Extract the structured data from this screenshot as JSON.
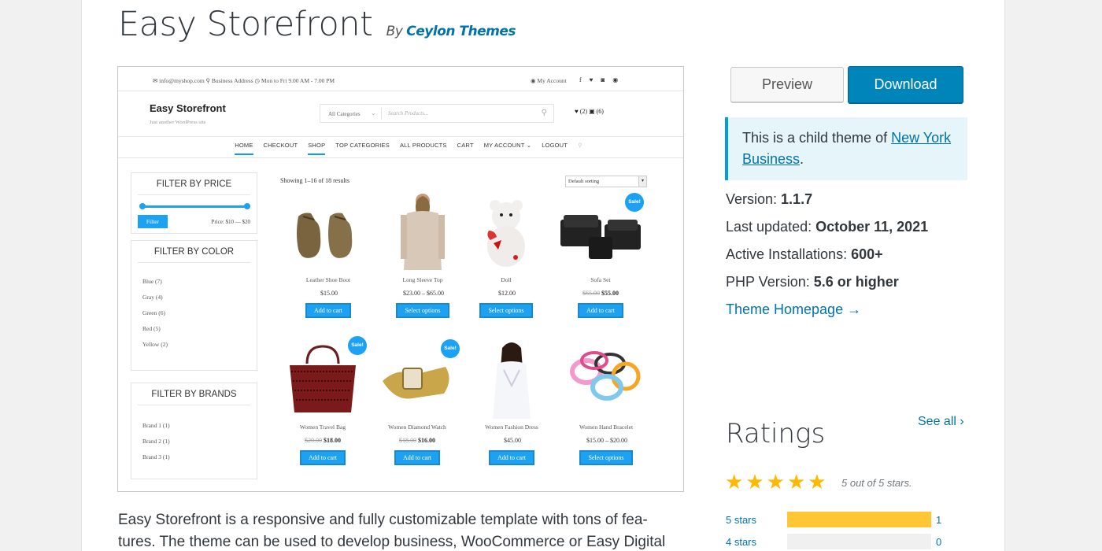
{
  "theme": {
    "title": "Easy Storefront",
    "by_prefix": "By",
    "author": "Ceylon Themes"
  },
  "screenshot": {
    "topbar": {
      "left": "✉ info@myshop.com   ⚲ Business Address   ◷ Mon to Fri 9.00 AM - 7.00 PM",
      "account": "◉ My Account"
    },
    "brand": "Easy Storefront",
    "tagline": "Just another WordPress site",
    "category": "All Categories",
    "search_placeholder": "Search Products...",
    "wish": "♥ (2)     ▣ (6)",
    "nav": [
      "HOME",
      "CHECKOUT",
      "SHOP",
      "TOP CATEGORIES",
      "ALL PRODUCTS",
      "CART",
      "MY ACCOUNT ⌄",
      "LOGOUT"
    ],
    "filter_price": {
      "title": "FILTER BY PRICE",
      "button": "Filter",
      "range": "Price: $10 — $20"
    },
    "filter_color": {
      "title": "FILTER BY COLOR",
      "items": [
        "Blue (7)",
        "Gray (4)",
        "Green (6)",
        "Red (5)",
        "Yellow (2)"
      ]
    },
    "filter_brands": {
      "title": "FILTER BY BRANDS",
      "items": [
        "Brand 1 (1)",
        "Brand 2 (1)",
        "Brand 3 (1)"
      ]
    },
    "result_count": "Showing 1–16 of 18 results",
    "sorting": "Default sorting",
    "sale_badge": "Sale!",
    "products": [
      {
        "name": "Leather Shoe Boot",
        "old": "",
        "price": "$15.00",
        "button": "Add to cart"
      },
      {
        "name": "Long Sleeve Top",
        "old": "",
        "price": "$23.00 – $65.00",
        "button": "Select options"
      },
      {
        "name": "Doll",
        "old": "",
        "price": "$12.00",
        "button": "Select options"
      },
      {
        "name": "Sofa Set",
        "old": "$65.00",
        "price": "$55.00",
        "button": "Add to cart"
      },
      {
        "name": "Women Travel Bag",
        "old": "$20.00",
        "price": "$18.00",
        "button": "Add to cart"
      },
      {
        "name": "Women Diamond Watch",
        "old": "$18.00",
        "price": "$16.00",
        "button": "Add to cart"
      },
      {
        "name": "Women Fashion Dress",
        "old": "",
        "price": "$45.00",
        "button": "Add to cart"
      },
      {
        "name": "Women Hand Bracelet",
        "old": "",
        "price": "$15.00 – $20.00",
        "button": "Select options"
      }
    ]
  },
  "buttons": {
    "preview": "Preview",
    "download": "Download"
  },
  "notice": {
    "prefix": "This is a child theme of ",
    "link": "New York Business",
    "suffix": "."
  },
  "meta": {
    "version_label": "Version: ",
    "version": "1.1.7",
    "updated_label": "Last updated: ",
    "updated": "October 11, 2021",
    "installs_label": "Active Installations: ",
    "installs": "600+",
    "php_label": "PHP Version: ",
    "php": "5.6 or higher",
    "homepage": "Theme Homepage →"
  },
  "ratings": {
    "title": "Ratings",
    "see_all": "See all ›",
    "stars_text": "5 out of 5 stars.",
    "rows": [
      {
        "label": "5 stars",
        "count": "1",
        "fraction": 1.0
      },
      {
        "label": "4 stars",
        "count": "0",
        "fraction": 0
      }
    ]
  },
  "description": "Easy Storefront is a responsive and fully customizable template with tons of fea-tures. The theme can be used to develop business, WooCommerce or Easy Digital",
  "colors": {
    "accent": "#0085ba",
    "link": "#0073aa",
    "notice_bg": "#e5f5fa",
    "star": "#ffb900",
    "shop_blue": "#1da1f2"
  }
}
